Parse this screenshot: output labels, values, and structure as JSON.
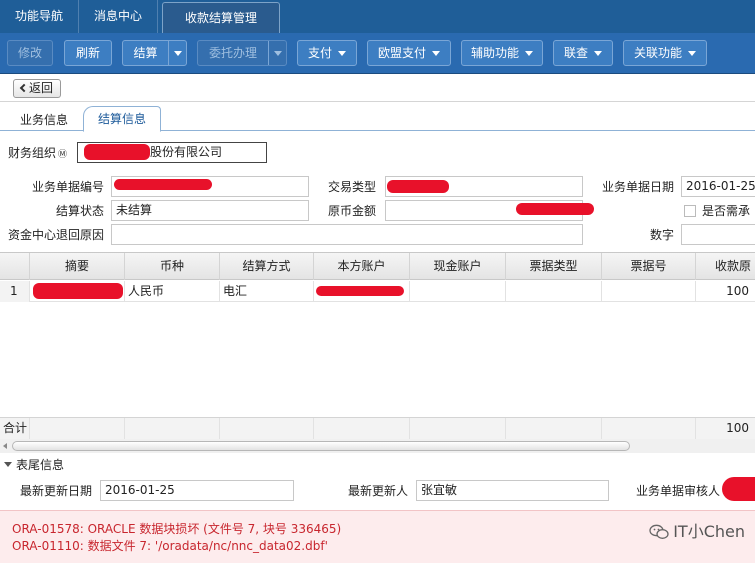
{
  "top_tabs": [
    "功能导航",
    "消息中心",
    "收款结算管理"
  ],
  "toolbar": {
    "modify": "修改",
    "refresh": "刷新",
    "settle": "结算",
    "entrust": "委托办理",
    "pay": "支付",
    "union_pay": "欧盟支付",
    "aux": "辅助功能",
    "link_query": "联查",
    "related": "关联功能"
  },
  "back_label": "返回",
  "sub_tabs": [
    "业务信息",
    "结算信息"
  ],
  "form": {
    "fin_org_label": "财务组织",
    "fin_org_marker": "Ⓜ",
    "fin_org_value": "股份有限公司",
    "bill_no_label": "业务单据编号",
    "trade_type_label": "交易类型",
    "bill_date_label": "业务单据日期",
    "bill_date_value": "2016-01-25",
    "settle_status_label": "结算状态",
    "settle_status_value": "未结算",
    "orig_amount_label": "原币金额",
    "need_confirm_label": "是否需承",
    "return_reason_label": "资金中心退回原因",
    "digit_label": "数字"
  },
  "grid": {
    "columns": [
      "摘要",
      "币种",
      "结算方式",
      "本方账户",
      "现金账户",
      "票据类型",
      "票据号",
      "收款原"
    ],
    "rows": [
      {
        "index": "1",
        "currency": "人民币",
        "method": "电汇",
        "amount": "100"
      }
    ],
    "total_label": "合计",
    "total_amount": "100"
  },
  "footer": {
    "section_title": "表尾信息",
    "update_date_label": "最新更新日期",
    "update_date_value": "2016-01-25",
    "updater_label": "最新更新人",
    "updater_value": "张宜敏",
    "auditor_label": "业务单据审核人"
  },
  "error": {
    "line1": "ORA-01578: ORACLE 数据块损坏 (文件号 7, 块号 336465)",
    "line2": "ORA-01110: 数据文件 7: '/oradata/nc/nnc_data02.dbf'"
  },
  "watermark": "IT小Chen",
  "colors": {
    "toolbar_blue": "#2a6ab0",
    "error_red": "#c8262e",
    "redaction": "#e8112a"
  }
}
